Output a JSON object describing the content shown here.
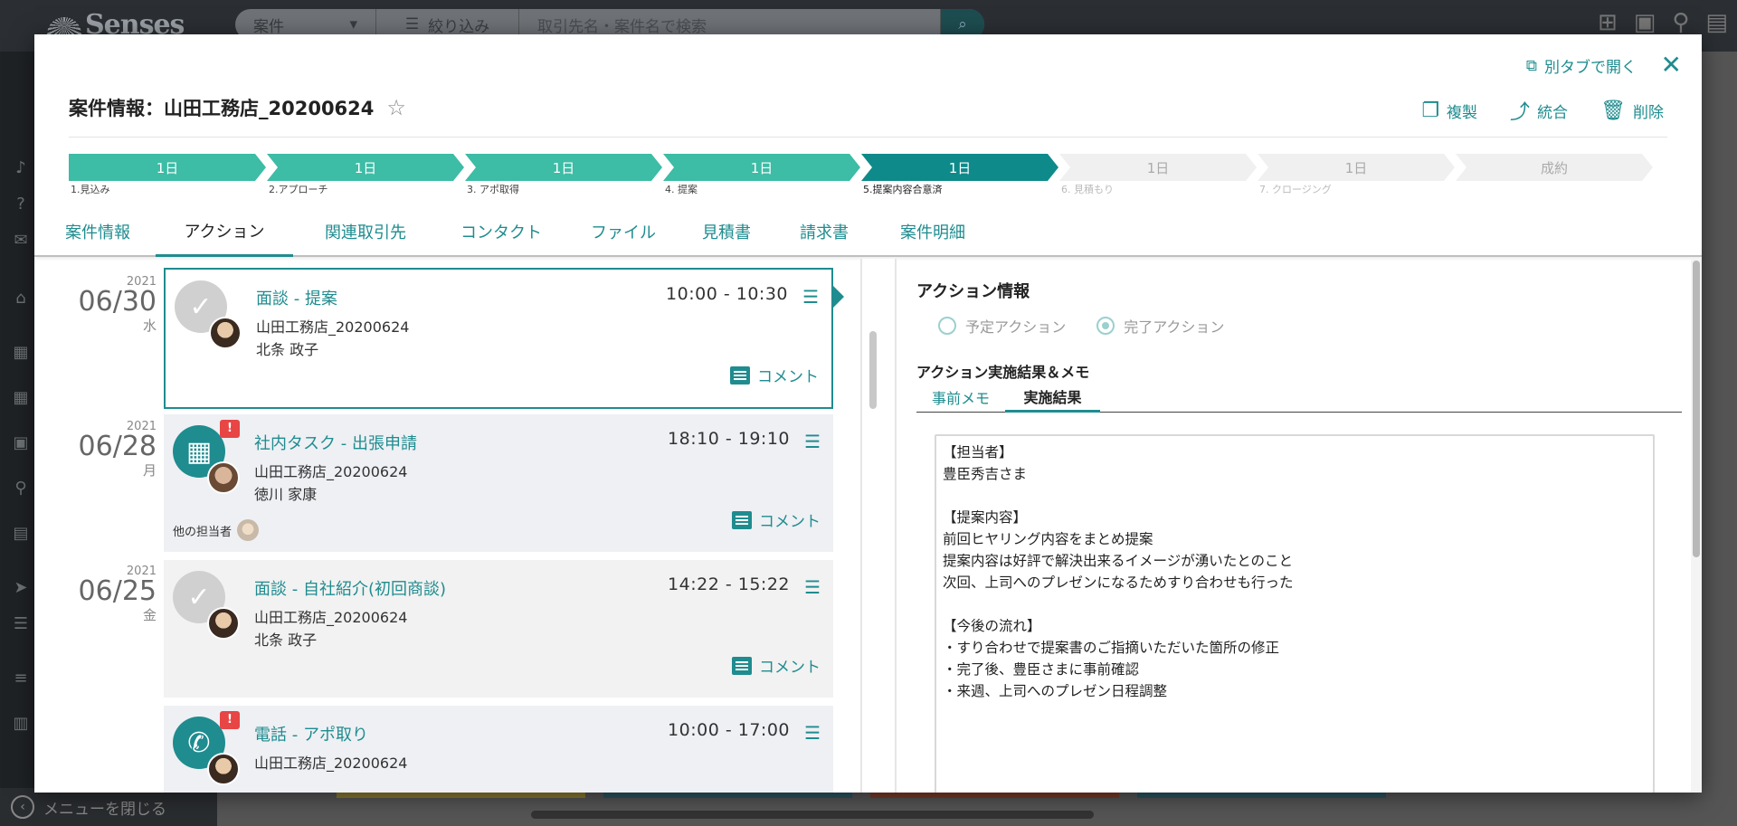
{
  "bg": {
    "logo": "Senses",
    "search_type": "案件",
    "filter_label": "絞り込み",
    "search_placeholder": "取引先名・案件名で検索",
    "menu_close": "メニューを閉じる"
  },
  "modal": {
    "title": "案件情報：山田工務店_20200624",
    "open_tab": "別タブで開く",
    "actions": {
      "duplicate": "複製",
      "merge": "統合",
      "delete": "削除"
    }
  },
  "pipeline": [
    {
      "days": "1日",
      "label": "1.見込み",
      "state": "done"
    },
    {
      "days": "1日",
      "label": "2.アプローチ",
      "state": "done"
    },
    {
      "days": "1日",
      "label": "3. アポ取得",
      "state": "done"
    },
    {
      "days": "1日",
      "label": "4. 提案",
      "state": "done"
    },
    {
      "days": "1日",
      "label": "5.提案内容合意済",
      "state": "current"
    },
    {
      "days": "1日",
      "label": "6. 見積もり",
      "state": "todo"
    },
    {
      "days": "1日",
      "label": "7. クロージング",
      "state": "todo"
    },
    {
      "days": "成約",
      "label": "",
      "state": "todo"
    }
  ],
  "tabs": [
    "案件情報",
    "アクション",
    "関連取引先",
    "コンタクト",
    "ファイル",
    "見積書",
    "請求書",
    "案件明細"
  ],
  "active_tab": "アクション",
  "actions_list": [
    {
      "year": "2021",
      "date": "06/30",
      "dow": "水",
      "title": "面談 - 提案",
      "time": "10:00 - 10:30",
      "company": "山田工務店_20200624",
      "person": "北条 政子",
      "comment": "コメント"
    },
    {
      "year": "2021",
      "date": "06/28",
      "dow": "月",
      "title": "社内タスク - 出張申請",
      "time": "18:10 - 19:10",
      "company": "山田工務店_20200624",
      "person": "徳川 家康",
      "others": "他の担当者",
      "comment": "コメント",
      "alert": "!"
    },
    {
      "year": "2021",
      "date": "06/25",
      "dow": "金",
      "title": "面談 - 自社紹介(初回商談)",
      "time": "14:22 - 15:22",
      "company": "山田工務店_20200624",
      "person": "北条 政子",
      "comment": "コメント"
    },
    {
      "title": "電話 - アポ取り",
      "time": "10:00 - 17:00",
      "company": "山田工務店_20200624",
      "alert": "!"
    }
  ],
  "detail": {
    "heading": "アクション情報",
    "radio_planned": "予定アクション",
    "radio_done": "完了アクション",
    "result_heading": "アクション実施結果＆メモ",
    "subtab_pre": "事前メモ",
    "subtab_result": "実施結果",
    "memo": "【担当者】\n豊臣秀吉さま\n\n【提案内容】\n前回ヒヤリング内容をまとめ提案\n提案内容は好評で解決出来るイメージが湧いたとのこと\n次回、上司へのプレゼンになるためすり合わせも行った\n\n【今後の流れ】\n・すり合わせで提案書のご指摘いただいた箇所の修正\n・完了後、豊臣さまに事前確認\n・来週、上司へのプレゼン日程調整"
  }
}
